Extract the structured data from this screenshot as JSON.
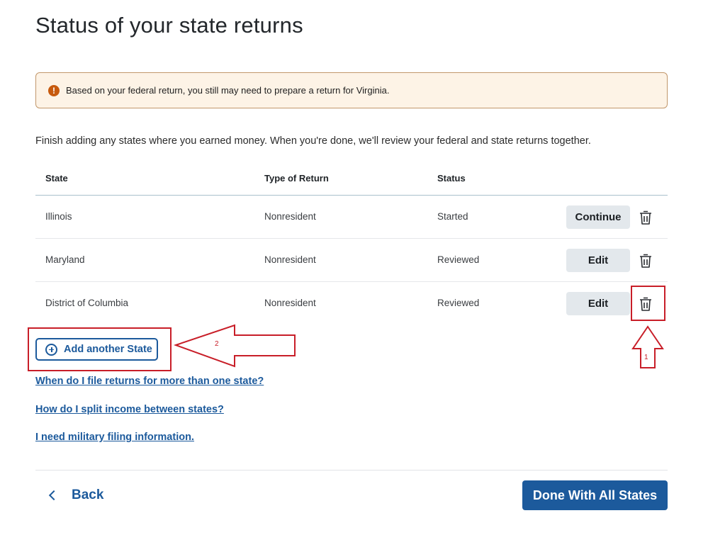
{
  "page": {
    "title": "Status of your state returns"
  },
  "alert": {
    "icon": "exclamation-icon",
    "text": "Based on your federal return, you still may need to prepare a return for Virginia."
  },
  "intro": "Finish adding any states where you earned money. When you're done, we'll review your federal and state returns together.",
  "table": {
    "headers": {
      "state": "State",
      "type": "Type of Return",
      "status": "Status"
    },
    "rows": [
      {
        "state": "Illinois",
        "type": "Nonresident",
        "status": "Started",
        "action": "Continue"
      },
      {
        "state": "Maryland",
        "type": "Nonresident",
        "status": "Reviewed",
        "action": "Edit"
      },
      {
        "state": "District of Columbia",
        "type": "Nonresident",
        "status": "Reviewed",
        "action": "Edit"
      }
    ]
  },
  "add_state": {
    "label": "Add another State"
  },
  "links": {
    "multi_state": "When do I file returns for more than one state?",
    "split_income": "How do I split income between states?",
    "military": "I need military filing information."
  },
  "footer": {
    "back_label": "Back",
    "done_label": "Done With All States"
  },
  "annotations": {
    "marker_1": "1",
    "marker_2": "2"
  },
  "colors": {
    "primary": "#1c5a9c",
    "annotation": "#c81e28",
    "alert_bg": "#fdf3e6",
    "alert_icon": "#c75a0e"
  }
}
